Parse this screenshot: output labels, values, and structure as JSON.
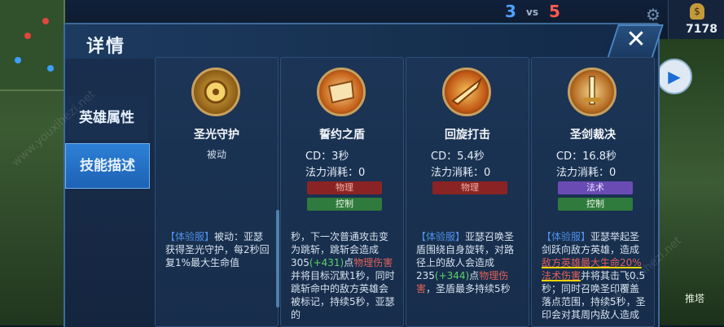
{
  "hud": {
    "score_blue": "3",
    "score_vs": "vs",
    "score_red": "5",
    "gold": "7178",
    "gold_symbol": "$",
    "right_label": "推塔"
  },
  "panel": {
    "title": "详情",
    "close_label": "✕",
    "tabs": [
      {
        "label": "英雄属性"
      },
      {
        "label": "技能描述"
      }
    ]
  },
  "skills": [
    {
      "name": "圣光守护",
      "type": "被动",
      "desc_prefix": "【体验服】",
      "desc": "被动：亚瑟获得圣光守护，每2秒回复1%最大生命值"
    },
    {
      "name": "誓约之盾",
      "cd": "CD：3秒",
      "mana": "法力消耗：0",
      "tags": [
        "物理",
        "控制"
      ],
      "desc_a": "秒，下一次普通攻击变为跳斩，跳斩会造成305",
      "desc_bonus": "(+431)",
      "desc_b": "点",
      "desc_dmg": "物理伤害",
      "desc_c": "并将目标沉默1秒，同时跳斩命中的敌方英雄会被标记，持续5秒，亚瑟的"
    },
    {
      "name": "回旋打击",
      "cd": "CD：5.4秒",
      "mana": "法力消耗：0",
      "tags": [
        "物理"
      ],
      "desc_prefix": "【体验服】",
      "desc_a": "亚瑟召唤圣盾围绕自身旋转，对路径上的敌人会造成235",
      "desc_bonus": "(+344)",
      "desc_b": "点",
      "desc_dmg": "物理伤害",
      "desc_c": "，圣盾最多持续5秒"
    },
    {
      "name": "圣剑裁决",
      "cd": "CD：16.8秒",
      "mana": "法力消耗：0",
      "tags": [
        "法术",
        "控制"
      ],
      "desc_prefix": "【体验服】",
      "desc_a": "亚瑟举起圣剑跃向敌方英雄，造成",
      "desc_hl": "敌方英雄最大生命20%法术伤害",
      "desc_c": "并将其击飞0.5秒；同时召唤圣印覆盖落点范围，持续5秒，圣印会对其周内敌人造成"
    }
  ],
  "watermark": "www.youxihezi.net"
}
